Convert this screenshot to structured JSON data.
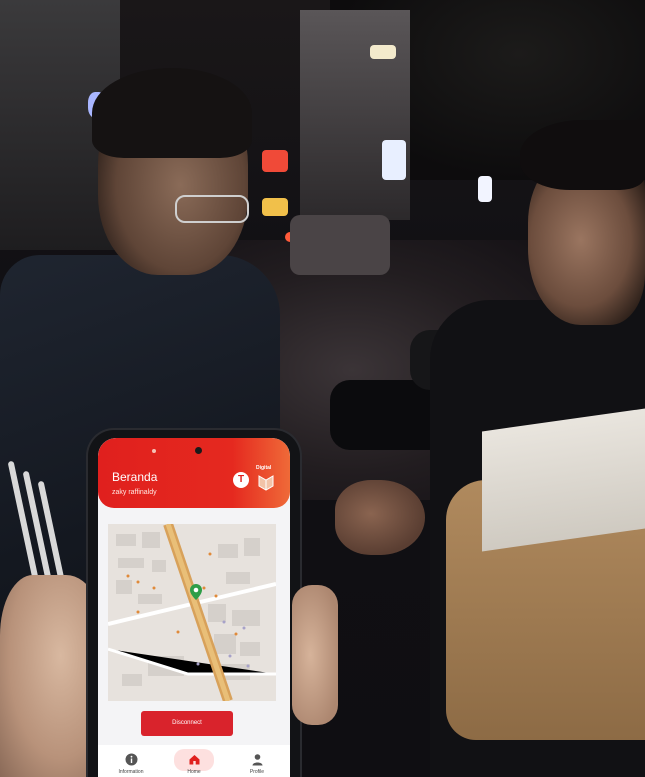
{
  "app": {
    "header": {
      "title": "Beranda",
      "subtitle": "zaky raffinaldy",
      "logo_letter": "T",
      "brand_text": "Digital"
    },
    "map": {
      "pin_color": "#2e9e48",
      "road_color": "#d8a15a"
    },
    "disconnect_button": {
      "label": "Disconnect",
      "color": "#d9232c"
    },
    "bottom_nav": {
      "items": [
        {
          "label": "Information",
          "icon": "info-icon"
        },
        {
          "label": "Home",
          "icon": "home-icon"
        },
        {
          "label": "Profile",
          "icon": "user-icon"
        }
      ]
    },
    "accent_color": "#e0201e"
  }
}
